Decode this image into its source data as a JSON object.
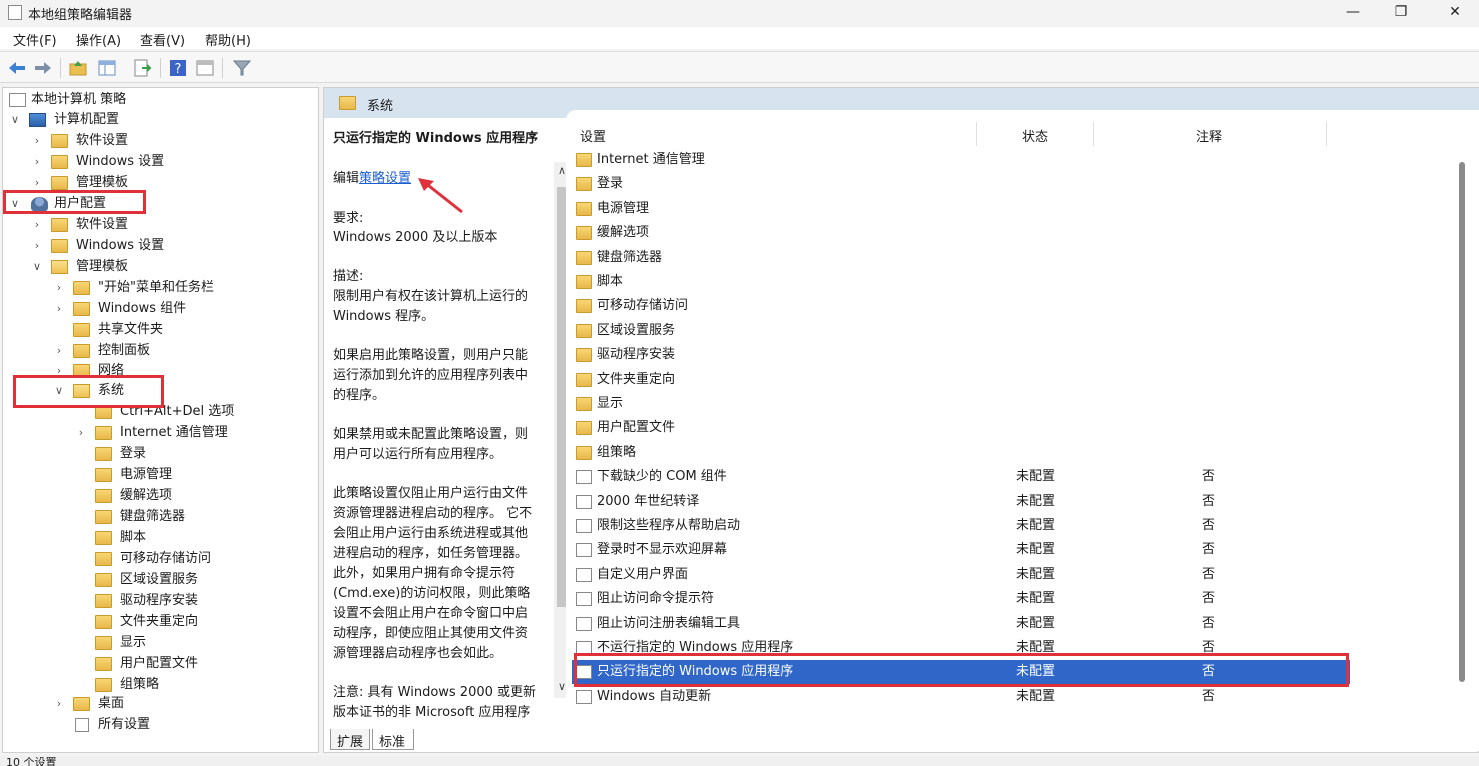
{
  "window": {
    "title": "本地组策略编辑器",
    "minimize": "—",
    "maximize": "❐",
    "close": "✕"
  },
  "menu": [
    "文件(F)",
    "操作(A)",
    "查看(V)",
    "帮助(H)"
  ],
  "toolbar": [
    "back-icon",
    "forward-icon",
    "up-folder-icon",
    "show-hide-tree-icon",
    "export-list-icon",
    "help-icon",
    "properties-icon",
    "filter-icon"
  ],
  "tree": {
    "root": "本地计算机 策略",
    "computer_config": "计算机配置",
    "computer_children": [
      "软件设置",
      "Windows 设置",
      "管理模板"
    ],
    "user_config": "用户配置",
    "user_children": [
      "软件设置",
      "Windows 设置",
      "管理模板"
    ],
    "admin_templates_children": [
      "\"开始\"菜单和任务栏",
      "Windows 组件",
      "共享文件夹",
      "控制面板",
      "网络",
      "系统"
    ],
    "system_children": [
      "Ctrl+Alt+Del 选项",
      "Internet 通信管理",
      "登录",
      "电源管理",
      "缓解选项",
      "键盘筛选器",
      "脚本",
      "可移动存储访问",
      "区域设置服务",
      "驱动程序安装",
      "文件夹重定向",
      "显示",
      "用户配置文件",
      "组策略"
    ],
    "after_system": [
      "桌面",
      "所有设置"
    ]
  },
  "right_header": "系统",
  "description": {
    "title": "只运行指定的 Windows 应用程序",
    "edit_prefix": "编辑",
    "edit_link": "策略设置",
    "requirements_label": "要求:",
    "requirements": "Windows 2000 及以上版本",
    "desc_label": "描述:",
    "desc_lines": [
      "限制用户有权在该计算机上运行的",
      "Windows 程序。"
    ],
    "p2_lines": [
      "如果启用此策略设置，则用户只能",
      "运行添加到允许的应用程序列表中",
      "的程序。"
    ],
    "p3_lines": [
      "如果禁用或未配置此策略设置，则",
      "用户可以运行所有应用程序。"
    ],
    "p4_lines": [
      "此策略设置仅阻止用户运行由文件",
      "资源管理器进程启动的程序。 它不",
      "会阻止用户运行由系统进程或其他",
      "进程启动的程序，如任务管理器。",
      "此外，如果用户拥有命令提示符",
      "(Cmd.exe)的访问权限，则此策略",
      "设置不会阻止用户在命令窗口中启",
      "动程序，即使应阻止其使用文件资",
      "源管理器启动程序也会如此。"
    ],
    "p5_lines": [
      "注意: 具有 Windows 2000 或更新",
      "版本证书的非 Microsoft 应用程序"
    ]
  },
  "tabs": [
    "扩展",
    "标准"
  ],
  "list": {
    "headers": {
      "setting": "设置",
      "state": "状态",
      "comment": "注释"
    },
    "folders": [
      "Internet 通信管理",
      "登录",
      "电源管理",
      "缓解选项",
      "键盘筛选器",
      "脚本",
      "可移动存储访问",
      "区域设置服务",
      "驱动程序安装",
      "文件夹重定向",
      "显示",
      "用户配置文件",
      "组策略"
    ],
    "policies": [
      {
        "name": "下载缺少的 COM 组件",
        "state": "未配置",
        "comment": "否"
      },
      {
        "name": "2000 年世纪转译",
        "state": "未配置",
        "comment": "否"
      },
      {
        "name": "限制这些程序从帮助启动",
        "state": "未配置",
        "comment": "否"
      },
      {
        "name": "登录时不显示欢迎屏幕",
        "state": "未配置",
        "comment": "否"
      },
      {
        "name": "自定义用户界面",
        "state": "未配置",
        "comment": "否"
      },
      {
        "name": "阻止访问命令提示符",
        "state": "未配置",
        "comment": "否"
      },
      {
        "name": "阻止访问注册表编辑工具",
        "state": "未配置",
        "comment": "否"
      },
      {
        "name": "不运行指定的 Windows 应用程序",
        "state": "未配置",
        "comment": "否"
      },
      {
        "name": "只运行指定的 Windows 应用程序",
        "state": "未配置",
        "comment": "否"
      },
      {
        "name": "Windows 自动更新",
        "state": "未配置",
        "comment": "否"
      }
    ]
  },
  "status": "10 个设置",
  "colors": {
    "highlight": "#e0303a",
    "selected": "#2f66c8",
    "header": "#d8e3f0"
  }
}
